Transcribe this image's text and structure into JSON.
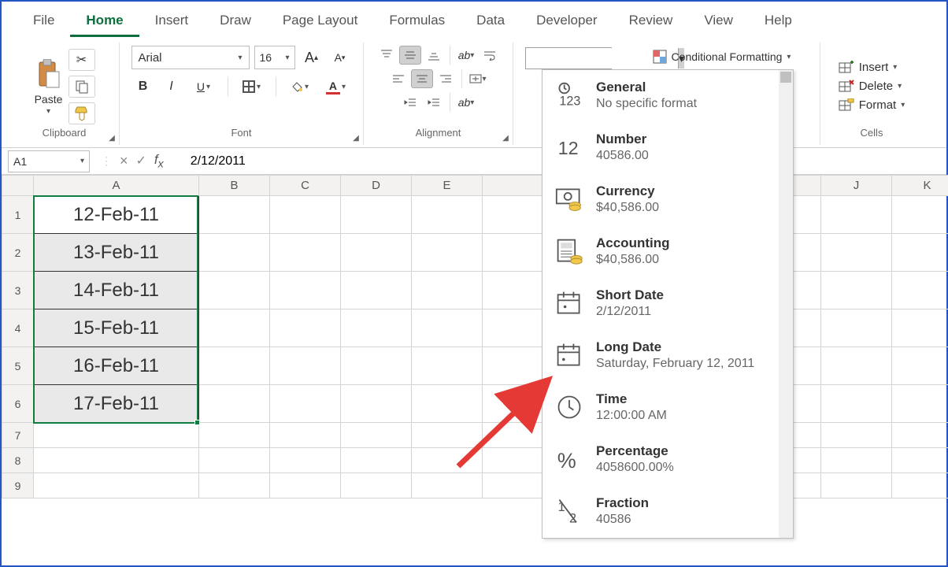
{
  "tabs": [
    "File",
    "Home",
    "Insert",
    "Draw",
    "Page Layout",
    "Formulas",
    "Data",
    "Developer",
    "Review",
    "View",
    "Help"
  ],
  "active_tab": "Home",
  "clipboard": {
    "paste": "Paste",
    "group": "Clipboard"
  },
  "font": {
    "name": "Arial",
    "size": "16",
    "group": "Font",
    "bold": "B",
    "italic": "I",
    "underline": "U"
  },
  "alignment": {
    "group": "Alignment"
  },
  "styles": {
    "cond": "Conditional Formatting"
  },
  "cells_group": {
    "insert": "Insert",
    "delete": "Delete",
    "format": "Format",
    "group": "Cells"
  },
  "formula_bar": {
    "cell_ref": "A1",
    "value": "2/12/2011"
  },
  "columns": [
    "A",
    "B",
    "C",
    "D",
    "E",
    "J",
    "K"
  ],
  "data_rows": [
    "12-Feb-11",
    "13-Feb-11",
    "14-Feb-11",
    "15-Feb-11",
    "16-Feb-11",
    "17-Feb-11"
  ],
  "fmt_items": [
    {
      "title": "General",
      "sub": "No specific format",
      "icon": "general"
    },
    {
      "title": "Number",
      "sub": "40586.00",
      "icon": "number"
    },
    {
      "title": "Currency",
      "sub": "$40,586.00",
      "icon": "currency"
    },
    {
      "title": "Accounting",
      "sub": " $40,586.00",
      "icon": "accounting"
    },
    {
      "title": "Short Date",
      "sub": "2/12/2011",
      "icon": "shortdate"
    },
    {
      "title": "Long Date",
      "sub": "Saturday, February 12, 2011",
      "icon": "longdate"
    },
    {
      "title": "Time",
      "sub": "12:00:00 AM",
      "icon": "time"
    },
    {
      "title": "Percentage",
      "sub": "4058600.00%",
      "icon": "percent"
    },
    {
      "title": "Fraction",
      "sub": "40586",
      "icon": "fraction"
    }
  ]
}
